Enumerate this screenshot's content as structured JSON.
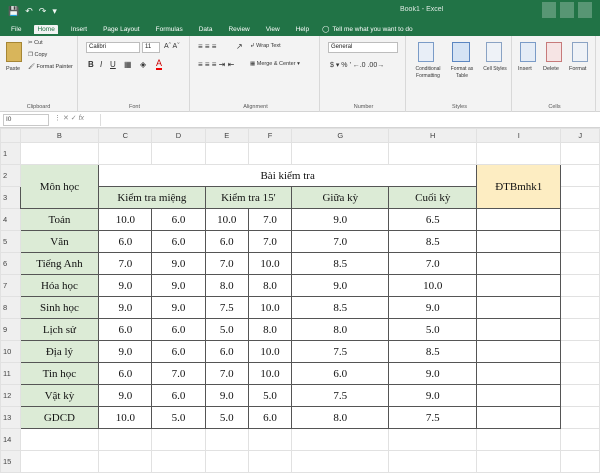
{
  "titlebar": {
    "title": "Book1 - Excel"
  },
  "menu": {
    "tabs": [
      "File",
      "Home",
      "Insert",
      "Page Layout",
      "Formulas",
      "Data",
      "Review",
      "View",
      "Help"
    ],
    "tell_me": "Tell me what you want to do"
  },
  "ribbon": {
    "clipboard": {
      "paste": "Paste",
      "cut": "Cut",
      "copy": "Copy",
      "format_painter": "Format Painter",
      "group": "Clipboard"
    },
    "font": {
      "name": "Calibri",
      "size": "11",
      "group": "Font"
    },
    "alignment": {
      "wrap": "Wrap Text",
      "merge": "Merge & Center",
      "group": "Alignment"
    },
    "number": {
      "format": "General",
      "group": "Number"
    },
    "styles": {
      "cond": "Conditional Formatting",
      "fmt_table": "Format as Table",
      "cell_styles": "Cell Styles",
      "group": "Styles"
    },
    "cells": {
      "insert": "Insert",
      "delete": "Delete",
      "format": "Format",
      "group": "Cells"
    }
  },
  "formula_bar": {
    "name_box": "I0",
    "fx": "fx",
    "content": ""
  },
  "sheet": {
    "columns": [
      "A",
      "B",
      "C",
      "D",
      "E",
      "F",
      "G",
      "H",
      "I",
      "J"
    ],
    "rows": [
      "1",
      "2",
      "3",
      "4",
      "5",
      "6",
      "7",
      "8",
      "9",
      "10",
      "11",
      "12",
      "13",
      "14",
      "15"
    ],
    "header_subject": "Môn học",
    "header_test": "Bài kiểm tra",
    "header_oral": "Kiểm tra miệng",
    "header_15": "Kiểm tra 15'",
    "header_mid": "Giữa kỳ",
    "header_final": "Cuối kỳ",
    "header_avg": "ĐTBmhk1",
    "data": [
      {
        "subject": "Toán",
        "c": "10.0",
        "d": "6.0",
        "e": "10.0",
        "f": "7.0",
        "g": "9.0",
        "h": "6.5"
      },
      {
        "subject": "Văn",
        "c": "6.0",
        "d": "6.0",
        "e": "6.0",
        "f": "7.0",
        "g": "7.0",
        "h": "8.5"
      },
      {
        "subject": "Tiếng Anh",
        "c": "7.0",
        "d": "9.0",
        "e": "7.0",
        "f": "10.0",
        "g": "8.5",
        "h": "7.0"
      },
      {
        "subject": "Hóa học",
        "c": "9.0",
        "d": "9.0",
        "e": "8.0",
        "f": "8.0",
        "g": "9.0",
        "h": "10.0"
      },
      {
        "subject": "Sinh học",
        "c": "9.0",
        "d": "9.0",
        "e": "7.5",
        "f": "10.0",
        "g": "8.5",
        "h": "9.0"
      },
      {
        "subject": "Lịch sử",
        "c": "6.0",
        "d": "6.0",
        "e": "5.0",
        "f": "8.0",
        "g": "8.0",
        "h": "5.0"
      },
      {
        "subject": "Địa lý",
        "c": "9.0",
        "d": "6.0",
        "e": "6.0",
        "f": "10.0",
        "g": "7.5",
        "h": "8.5"
      },
      {
        "subject": "Tin học",
        "c": "6.0",
        "d": "7.0",
        "e": "7.0",
        "f": "10.0",
        "g": "6.0",
        "h": "9.0"
      },
      {
        "subject": "Vật kỳ",
        "c": "9.0",
        "d": "6.0",
        "e": "9.0",
        "f": "5.0",
        "g": "7.5",
        "h": "9.0"
      },
      {
        "subject": "GDCD",
        "c": "10.0",
        "d": "5.0",
        "e": "5.0",
        "f": "6.0",
        "g": "8.0",
        "h": "7.5"
      }
    ]
  },
  "colors": {
    "excel_green": "#217346",
    "header_green": "#dcebd6",
    "avg_yellow": "#fdedc2"
  }
}
